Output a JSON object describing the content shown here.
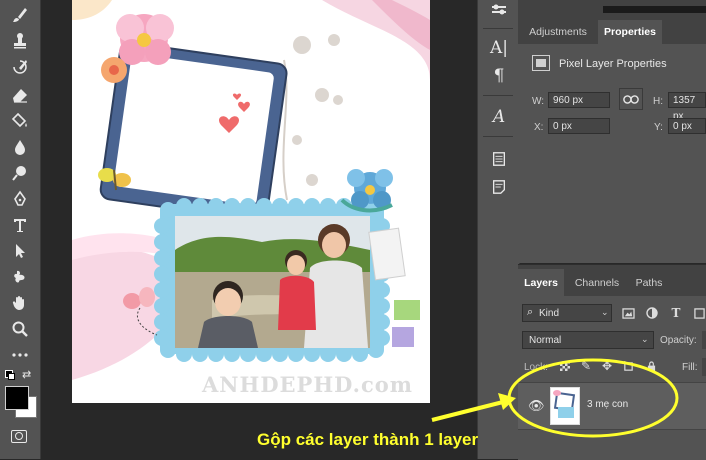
{
  "toolbar": {
    "tools": [
      "brush-icon",
      "stamp-icon",
      "history-brush-icon",
      "eraser-icon",
      "paint-bucket-icon",
      "blur-drop-icon",
      "dodge-icon",
      "pen-icon",
      "type-tool-icon",
      "path-select-icon",
      "shape-tool-icon",
      "hand-icon",
      "zoom-icon",
      "more-icon"
    ]
  },
  "canvas": {
    "watermark": "ANHDEPHD.com"
  },
  "dock": {
    "icons": [
      "character-panel-icon",
      "paragraph-panel-icon",
      "glyphs-panel-icon",
      "styles-panel-icon",
      "notes-panel-icon"
    ]
  },
  "properties": {
    "tabs": {
      "adjustments": "Adjustments",
      "properties": "Properties"
    },
    "heading": "Pixel Layer Properties",
    "w_label": "W:",
    "w_value": "960 px",
    "h_label": "H:",
    "h_value": "1357 px",
    "x_label": "X:",
    "x_value": "0 px",
    "y_label": "Y:",
    "y_value": "0 px"
  },
  "layers": {
    "tabs": {
      "layers": "Layers",
      "channels": "Channels",
      "paths": "Paths"
    },
    "filter_kind": "Kind",
    "blend_mode": "Normal",
    "opacity_label": "Opacity:",
    "lock_label": "Lock:",
    "fill_label": "Fill:",
    "layer_name": "3 mẹ con"
  },
  "annotation": {
    "caption": "Gộp các layer thành 1 layer",
    "color": "#ffff2e"
  }
}
